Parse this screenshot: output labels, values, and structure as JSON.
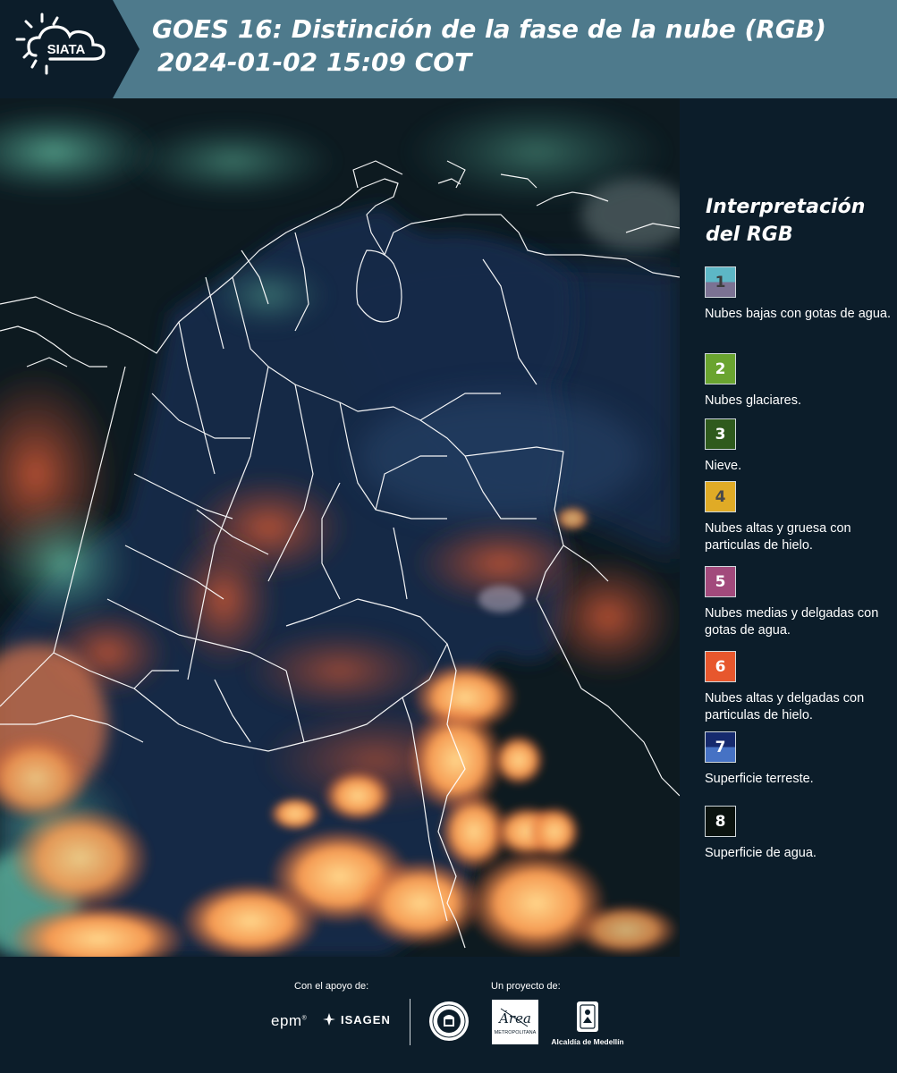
{
  "header": {
    "logo_text": "SIATA",
    "title_line1": "GOES 16: Distinción de la fase de la nube (RGB)",
    "title_line2": "2024-01-02 15:09 COT"
  },
  "legend": {
    "title": "Interpretación del RGB",
    "items": [
      {
        "num": "1",
        "label": "Nubes bajas con gotas de agua.",
        "color_top": "#5db7c6",
        "color_bottom": "#7b7293",
        "num_color": "#3c3c3c"
      },
      {
        "num": "2",
        "label": "Nubes glaciares.",
        "color_top": "#6aa430",
        "color_bottom": "#6aa430",
        "num_color": "#ffffff"
      },
      {
        "num": "3",
        "label": "Nieve.",
        "color_top": "#2f5a1d",
        "color_bottom": "#2f5a1d",
        "num_color": "#ffffff"
      },
      {
        "num": "4",
        "label": "Nubes altas y gruesa con particulas de hielo.",
        "color_top": "#e0ab26",
        "color_bottom": "#e0ab26",
        "num_color": "#4a4a4a"
      },
      {
        "num": "5",
        "label": "Nubes medias y delgadas con gotas de agua.",
        "color_top": "#a24a7c",
        "color_bottom": "#a24a7c",
        "num_color": "#ffffff"
      },
      {
        "num": "6",
        "label": "Nubes altas y delgadas con particulas de hielo.",
        "color_top": "#e7572d",
        "color_bottom": "#e7572d",
        "num_color": "#ffffff"
      },
      {
        "num": "7",
        "label": "Superficie terreste.",
        "color_top": "#162a6e",
        "color_bottom": "#4672c4",
        "num_color": "#ffffff"
      },
      {
        "num": "8",
        "label": "Superficie de agua.",
        "color_top": "#0b130f",
        "color_bottom": "#0b130f",
        "num_color": "#ffffff"
      }
    ]
  },
  "footer": {
    "support_label": "Con el apoyo de:",
    "project_label": "Un proyecto de:",
    "epm": "epm",
    "isagen": "ISAGEN",
    "amva_text": "Área",
    "amva_sub": "METROPOLITANA",
    "medellin": "Alcaldía de Medellín"
  },
  "colors": {
    "header_bg": "#4e7a8c",
    "logo_bg": "#0c1d2a",
    "panel_bg": "#0c1d2a"
  }
}
